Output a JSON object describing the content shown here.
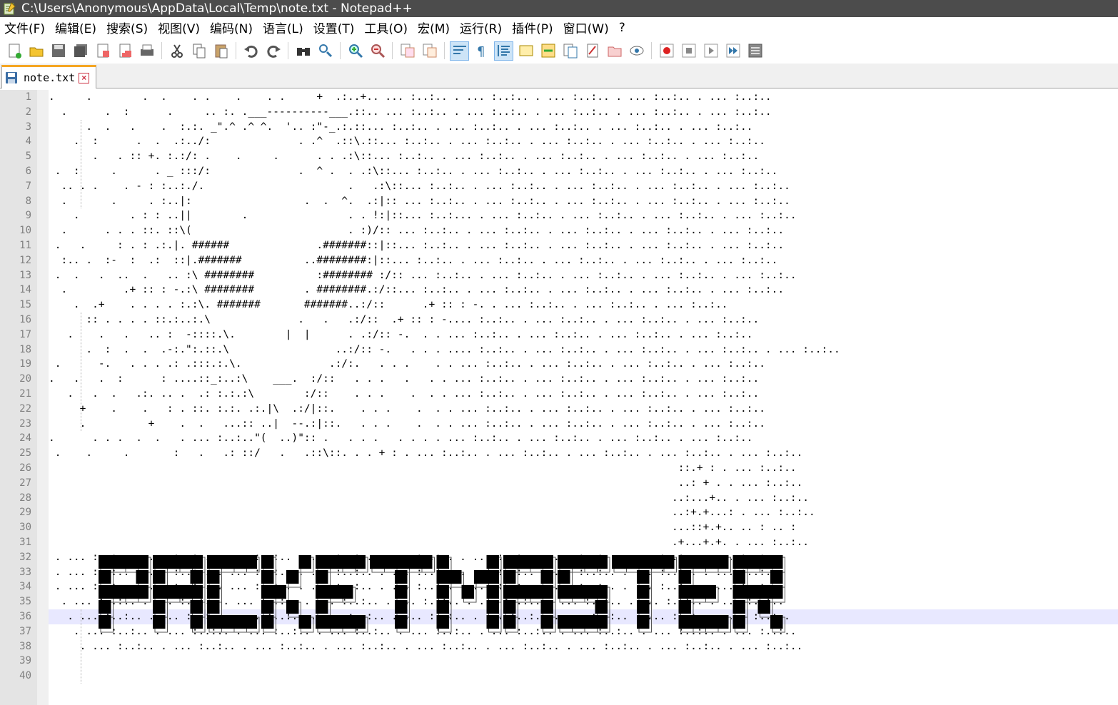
{
  "window": {
    "title": "C:\\Users\\Anonymous\\AppData\\Local\\Temp\\note.txt - Notepad++"
  },
  "menu": [
    "文件(F)",
    "编辑(E)",
    "搜索(S)",
    "视图(V)",
    "编码(N)",
    "语言(L)",
    "设置(T)",
    "工具(O)",
    "宏(M)",
    "运行(R)",
    "插件(P)",
    "窗口(W)",
    "?"
  ],
  "toolbar": {
    "icons": [
      "new-file-icon",
      "open-file-icon",
      "save-icon",
      "save-all-icon",
      "close-icon",
      "close-all-icon",
      "print-icon",
      "cut-icon",
      "copy-icon",
      "paste-icon",
      "undo-icon",
      "redo-icon",
      "find-icon",
      "replace-icon",
      "zoom-in-icon",
      "zoom-out-icon",
      "sync-vertical-icon",
      "sync-horizontal-icon",
      "word-wrap-icon",
      "show-all-chars-icon",
      "indent-guide-icon",
      "udl-icon",
      "document-map-icon",
      "function-list-icon",
      "folder-workspace-icon",
      "monitoring-icon",
      "eye-icon",
      "record-macro-icon",
      "stop-record-icon",
      "playback-icon",
      "run-macro-multiple-icon",
      "save-macro-icon"
    ]
  },
  "tab": {
    "label": "note.txt"
  },
  "editor": {
    "current_line": 36,
    "banner_text": "PACKETMASTER",
    "lines": [
      ".     .        .  .    . .    .    . .     +  .:..+.. ... :..:.. . ... :..:.. . ... :..:.. . ... :..:.. . ... :..:..",
      "  .      .  :      .     .. :. .___----------___.::.. ... :..:.. . ... :..:.. . ... :..:.. . ... :..:.. . ... :..:..",
      "      .  .   .    .  :.:. _\".^ .^ ^.  '.. :\"-_.:.::... :..:.. . ... :..:.. . ... :..:.. . ... :..:.. . ... :..:..",
      "    .  :      .  .  .:../:              . .^  .::\\.::... :..:.. . ... :..:.. . ... :..:.. . ... :..:.. . ... :..:..",
      "       .   . :: +. :.:/: .    .     .      . . .:\\::... :..:.. . ... :..:.. . ... :..:.. . ... :..:.. . ... :..:..",
      " .  :     .      . _ :::/:              .  ^ .  . .:\\::... :..:.. . ... :..:.. . ... :..:.. . ... :..:.. . ... :..:..",
      "  .. . .    . - : :..:./.                       .   .:\\::... :..:.. . ... :..:.. . ... :..:.. . ... :..:.. . ... :..:..",
      "  .       .     . :..|:                  .  .  ^.  .:|:: ... :..:.. . ... :..:.. . ... :..:.. . ... :..:.. . ... :..:..",
      "    .        . : : ..||        .                . . !:|::... :..:... . ... :..:.. . ... :..:.. . ... :..:.. . ... :..:..",
      "  .      . . . ::. ::\\(                         . :)/:: ... :..:.. . ... :..:.. . ... :..:.. . ... :..:.. . ... :..:..",
      " .   .     : . : .:.|. ######              .#######::|::... :..:.. . ... :..:.. . ... :..:.. . ... :..:.. . ... :..:..",
      "  :.. .  :-  :  .:  ::|.#######          ..########:|::... :..:.. . ... :..:.. . ... :..:.. . ... :..:.. . ... :..:..",
      " .  .   .  ..  .   .. :\\ ########          :######## :/:: ... :..:.. . ... :..:.. . ... :..:.. . ... :..:.. . ... :..:..",
      "  .         .+ :: : -.:\\ ########        . ########.:/::... :..:.. . ... :..:.. . ... :..:.. . ... :..:.. . ... :..:..",
      "    .  .+    . . . . :.:\\. #######       #######..:/::      .+ :: : -. . ... :..:.. . ... :..:.. . ... :..:..",
      "      :: . . . . ::.:..:.\\              .   .   .:/::  .+ :: : -.... :..:.. . ... :..:.. . ... :..:.. . ... :..:..",
      "   .    .   .   .. :  -::::.\\.        |  |      . .:/:: -.  . . ... :..:.. . ... :..:.. . ... :..:.. . ... :..:..",
      "      .  :  .  .  .-:.\":.::.\\                 ..:/:: -.   . . . .... :..:.. . ... :..:.. . ... :..:.. . ... :..:.. . ... :..:..",
      " .      -.   . . . .: .:::.:.\\.              .:/:.   . . .    . . ... :..:.. . ... :..:.. . ... :..:.. . ... :..:..",
      ".   .   .  :      : ....::_:..:\\    ___.  :/::   . . .   .   . . ... :..:.. . ... :..:.. . ... :..:.. . ... :..:..",
      "   .   .  .   .:. .. .  .: :.:.:\\        :/::    . . .    .  . . ... :..:.. . ... :..:.. . ... :..:.. . ... :..:..",
      "     +    .    .   : . ::. :.:. .:.|\\  .:/|::.    . . .    .  . . ... :..:.. . ... :..:.. . ... :..:.. . ... :..:..",
      "     .          +    .  .   ...:: ..|  --.:|::.   . . .    .  . . ... :..:.. . ... :..:.. . ... :..:.. . ... :..:..",
      ".      . . .  .  .   . ... :..:..\"(  ..)\":: .   . . .   . . . . ... :..:.. . ... :..:.. . ... :..:.. . ... :..:..",
      " .    .     .       :   .   .: ::/   .   .::\\::. . . + : . ... :..:.. . ... :..:.. . ... :..:.. . ... :..:.. . ... :..:..",
      "                                                                                                     ::.+ : . ... :..:..",
      "                                                                                                     ..: + . . ... :..:..",
      "                                                                                                    ..:...+.. . ... :..:..",
      "                                                                                                    ..:+.+...: . ... :..:..",
      "                                                                                                    ...::+.+.. .. : .. :",
      "                                                                                                    .+...+.+. . ... :..:..",
      " . ... :..:.. . ... :..:.. . ... :..:.. . ... :..:.. . ... :..:.. . ... :..:.. . ... :..:.. . ... :..:.. . ... :..:..",
      " . ... :..:.. . ... :..:.. . ... :..:.. . ... :..:.. . ... :..:.. . ... :..:.. . ... :..:.. . ... :..:.. . ... :..:..",
      " . ... :..:.. . ... :..:.. . ... :..:.. . ... :..:.. . ... :..:.. . ... :..:.. . ... :..:.. . ... :..:.. . ... :..:..",
      "  . ... :..:.. . ... :..:.. . ... :..:.. . ... :..:.. . ... :..:.. . ... :..:.. . ... :..:.. . ... :..:.. . ... :..:..",
      "   . ... :..:.. . ... :..:.. . ... :..:.. . ... :..:.. . ... :..:.. . ... :..:.. . ... :..:.. . ... :..:.. . ... :..:..",
      "    . ... :..:.. . ... :..:.. . ... :..:.. . ... :..:.. . ... :..:.. . ... :..:.. . ... :..:.. . ... :..:.. . ... :..:..",
      "     . ... :..:.. . ... :..:.. . ... :..:.. . ... :..:.. . ... :..:.. . ... :..:.. . ... :..:.. . ... :..:.. . ... :..:..",
      "",
      ""
    ]
  }
}
